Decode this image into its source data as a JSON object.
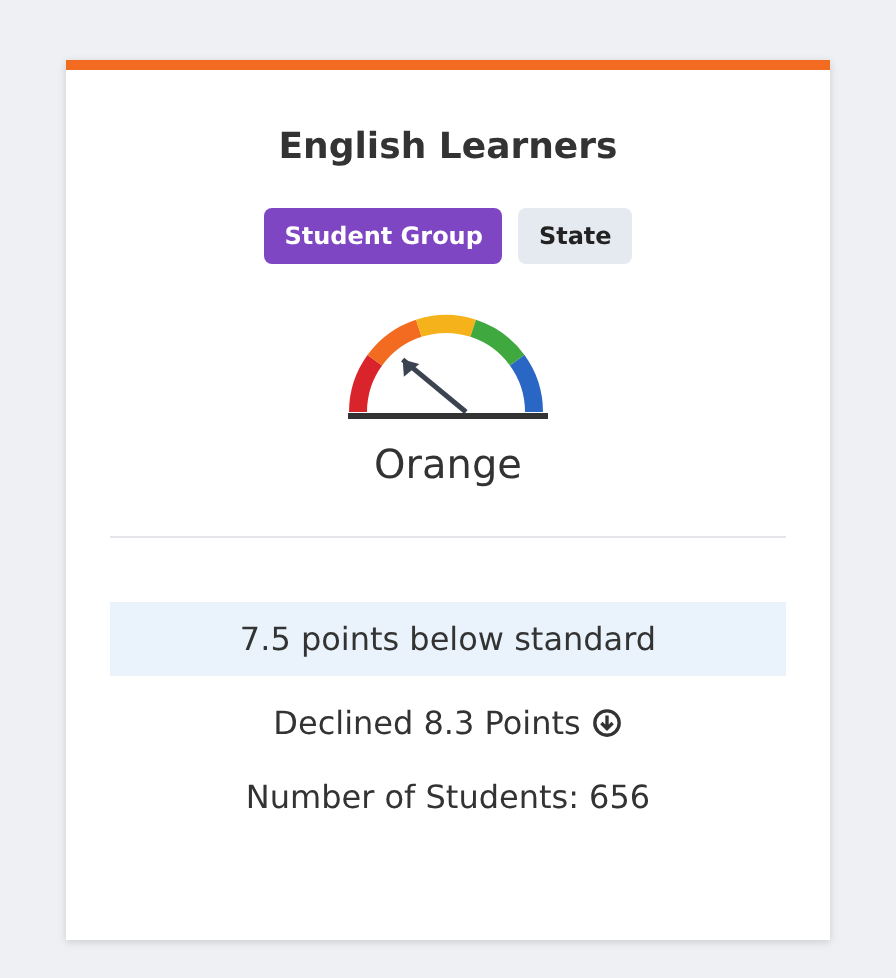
{
  "card": {
    "title": "English Learners",
    "tabs": [
      {
        "label": "Student Group",
        "selected": true
      },
      {
        "label": "State",
        "selected": false
      }
    ],
    "gauge": {
      "status": "Orange"
    },
    "distance": "7.5 points below standard",
    "change": {
      "text": "Declined 8.3 Points"
    },
    "count": "Number of Students: 656"
  }
}
